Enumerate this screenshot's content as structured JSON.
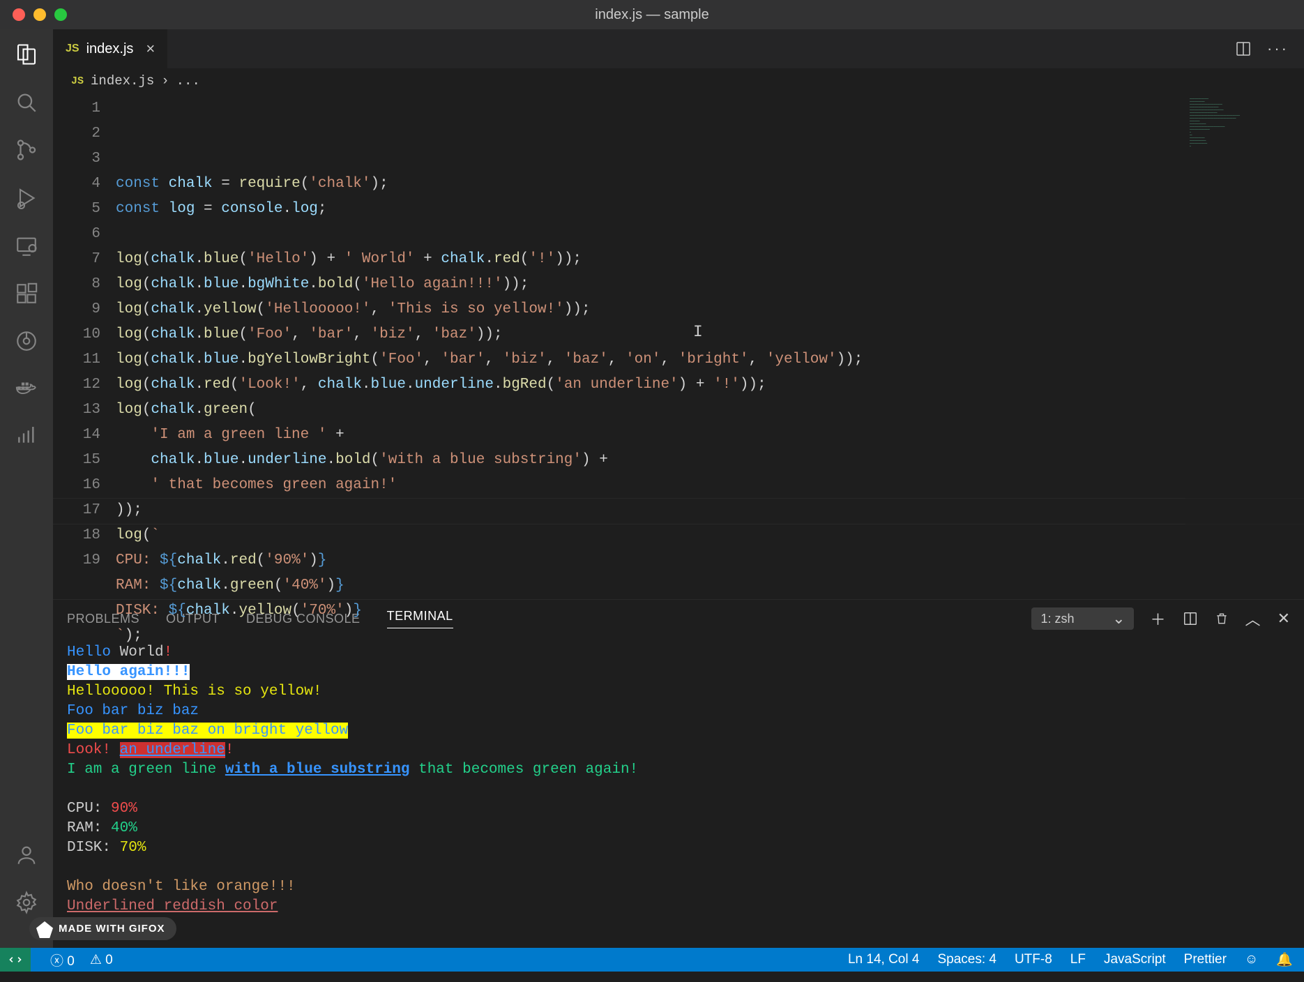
{
  "window": {
    "title": "index.js — sample"
  },
  "tab": {
    "filename": "index.js",
    "lang_badge": "JS"
  },
  "breadcrumb": {
    "filename": "index.js",
    "sep": "›",
    "tail": "..."
  },
  "code": {
    "lines": [
      {
        "n": "1",
        "html": "<span class='kw'>const</span> <span class='var'>chalk</span> <span class='pun'>=</span> <span class='fn'>require</span><span class='pun'>(</span><span class='str'>'chalk'</span><span class='pun'>);</span>"
      },
      {
        "n": "2",
        "html": "<span class='kw'>const</span> <span class='var'>log</span> <span class='pun'>=</span> <span class='var'>console</span><span class='pun'>.</span><span class='prop'>log</span><span class='pun'>;</span>"
      },
      {
        "n": "3",
        "html": ""
      },
      {
        "n": "4",
        "html": "<span class='fn'>log</span><span class='pun'>(</span><span class='var'>chalk</span><span class='pun'>.</span><span class='fn'>blue</span><span class='pun'>(</span><span class='str'>'Hello'</span><span class='pun'>) + </span><span class='str'>' World'</span><span class='pun'> + </span><span class='var'>chalk</span><span class='pun'>.</span><span class='fn'>red</span><span class='pun'>(</span><span class='str'>'!'</span><span class='pun'>));</span>"
      },
      {
        "n": "5",
        "html": "<span class='fn'>log</span><span class='pun'>(</span><span class='var'>chalk</span><span class='pun'>.</span><span class='prop'>blue</span><span class='pun'>.</span><span class='prop'>bgWhite</span><span class='pun'>.</span><span class='fn'>bold</span><span class='pun'>(</span><span class='str'>'Hello again!!!'</span><span class='pun'>));</span>"
      },
      {
        "n": "6",
        "html": "<span class='fn'>log</span><span class='pun'>(</span><span class='var'>chalk</span><span class='pun'>.</span><span class='fn'>yellow</span><span class='pun'>(</span><span class='str'>'Hellooooo!'</span><span class='pun'>, </span><span class='str'>'This is so yellow!'</span><span class='pun'>));</span>"
      },
      {
        "n": "7",
        "html": "<span class='fn'>log</span><span class='pun'>(</span><span class='var'>chalk</span><span class='pun'>.</span><span class='fn'>blue</span><span class='pun'>(</span><span class='str'>'Foo'</span><span class='pun'>, </span><span class='str'>'bar'</span><span class='pun'>, </span><span class='str'>'biz'</span><span class='pun'>, </span><span class='str'>'baz'</span><span class='pun'>));</span>"
      },
      {
        "n": "8",
        "html": "<span class='fn'>log</span><span class='pun'>(</span><span class='var'>chalk</span><span class='pun'>.</span><span class='prop'>blue</span><span class='pun'>.</span><span class='fn'>bgYellowBright</span><span class='pun'>(</span><span class='str'>'Foo'</span><span class='pun'>, </span><span class='str'>'bar'</span><span class='pun'>, </span><span class='str'>'biz'</span><span class='pun'>, </span><span class='str'>'baz'</span><span class='pun'>, </span><span class='str'>'on'</span><span class='pun'>, </span><span class='str'>'bright'</span><span class='pun'>, </span><span class='str'>'yellow'</span><span class='pun'>));</span>"
      },
      {
        "n": "9",
        "html": "<span class='fn'>log</span><span class='pun'>(</span><span class='var'>chalk</span><span class='pun'>.</span><span class='fn'>red</span><span class='pun'>(</span><span class='str'>'Look!'</span><span class='pun'>, </span><span class='var'>chalk</span><span class='pun'>.</span><span class='prop'>blue</span><span class='pun'>.</span><span class='prop'>underline</span><span class='pun'>.</span><span class='fn'>bgRed</span><span class='pun'>(</span><span class='str'>'an underline'</span><span class='pun'>) + </span><span class='str'>'!'</span><span class='pun'>));</span>"
      },
      {
        "n": "10",
        "html": "<span class='fn'>log</span><span class='pun'>(</span><span class='var'>chalk</span><span class='pun'>.</span><span class='fn'>green</span><span class='pun'>(</span>"
      },
      {
        "n": "11",
        "html": "    <span class='str'>'I am a green line '</span> <span class='pun'>+</span>"
      },
      {
        "n": "12",
        "html": "    <span class='var'>chalk</span><span class='pun'>.</span><span class='prop'>blue</span><span class='pun'>.</span><span class='prop'>underline</span><span class='pun'>.</span><span class='fn'>bold</span><span class='pun'>(</span><span class='str'>'with a blue substring'</span><span class='pun'>) +</span>"
      },
      {
        "n": "13",
        "html": "    <span class='str'>' that becomes green again!'</span>"
      },
      {
        "n": "14",
        "html": "<span class='pun'>));</span>",
        "current": true
      },
      {
        "n": "15",
        "html": "<span class='fn'>log</span><span class='pun'>(</span><span class='str'>`</span>"
      },
      {
        "n": "16",
        "html": "<span class='str'>CPU: </span><span class='tmp'>${</span><span class='var'>chalk</span><span class='pun'>.</span><span class='fn'>red</span><span class='pun'>(</span><span class='str'>'90%'</span><span class='pun'>)</span><span class='tmp'>}</span>"
      },
      {
        "n": "17",
        "html": "<span class='str'>RAM: </span><span class='tmp'>${</span><span class='var'>chalk</span><span class='pun'>.</span><span class='fn'>green</span><span class='pun'>(</span><span class='str'>'40%'</span><span class='pun'>)</span><span class='tmp'>}</span>"
      },
      {
        "n": "18",
        "html": "<span class='str'>DISK: </span><span class='tmp'>${</span><span class='var'>chalk</span><span class='pun'>.</span><span class='fn'>yellow</span><span class='pun'>(</span><span class='str'>'70%'</span><span class='pun'>)</span><span class='tmp'>}</span>"
      },
      {
        "n": "19",
        "html": "<span class='str'>`</span><span class='pun'>);</span>"
      }
    ]
  },
  "panel": {
    "tabs": [
      "PROBLEMS",
      "OUTPUT",
      "DEBUG CONSOLE",
      "TERMINAL"
    ],
    "active": "TERMINAL",
    "shell": "1: zsh"
  },
  "terminal": {
    "lines": [
      "<span class='t-blue'>Hello</span> World<span class='t-red'>!</span>",
      "<span class='t-bgw'>Hello again!!!</span>",
      "<span class='t-yellow'>Hellooooo! This is so yellow!</span>",
      "<span class='t-blue'>Foo bar biz baz</span>",
      "<span class='t-bgyb'>Foo bar biz baz on bright yellow</span>",
      "<span class='t-red'>Look! </span><span class='t-bgr'>an underline</span><span class='t-red'>!</span>",
      "<span class='t-green'>I am a green line </span><span class='t-ulb'>with a blue substring</span><span class='t-green'> that becomes green again!</span>",
      "",
      "CPU: <span class='t-red'>90%</span>",
      "RAM: <span class='t-green'>40%</span>",
      "DISK: <span class='t-yellow'>70%</span>",
      "",
      "<span class='t-orange'>Who doesn't like orange!!!</span>",
      "<span class='t-ulr'>Underlined reddish color</span>",
      "<span style='color:#888'>!</span>"
    ]
  },
  "status": {
    "errors": "0",
    "warnings": "0",
    "position": "Ln 14, Col 4",
    "spaces": "Spaces: 4",
    "encoding": "UTF-8",
    "eol": "LF",
    "language": "JavaScript",
    "formatter": "Prettier"
  },
  "gifox": "MADE WITH GIFOX"
}
